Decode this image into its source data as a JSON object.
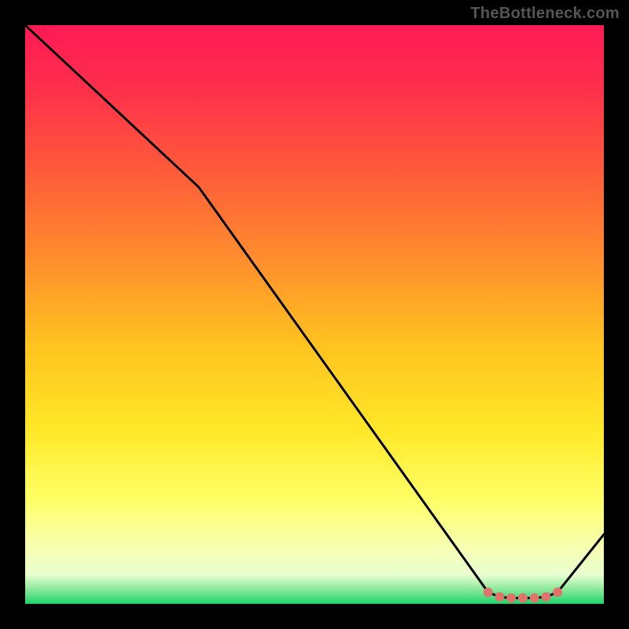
{
  "watermark": "TheBottleneck.com",
  "chart_data": {
    "type": "line",
    "title": "",
    "xlabel": "",
    "ylabel": "",
    "xlim": [
      0,
      100
    ],
    "ylim": [
      0,
      100
    ],
    "grid": false,
    "series": [
      {
        "name": "curve",
        "x": [
          0,
          30,
          80,
          82,
          84,
          86,
          88,
          90,
          92,
          100
        ],
        "values": [
          100,
          72,
          2,
          1.2,
          1,
          1,
          1,
          1.2,
          2,
          12
        ]
      }
    ],
    "markers": {
      "x": [
        80,
        82,
        84,
        86,
        88,
        90,
        92
      ],
      "values": [
        2,
        1.2,
        1,
        1,
        1,
        1.2,
        2
      ],
      "color": "#e0746b"
    },
    "background_gradient_stops": [
      {
        "offset": 0.0,
        "color": "#ff1a55"
      },
      {
        "offset": 0.1,
        "color": "#ff2d4d"
      },
      {
        "offset": 0.25,
        "color": "#ff5a3a"
      },
      {
        "offset": 0.4,
        "color": "#ff8c2e"
      },
      {
        "offset": 0.55,
        "color": "#ffc21f"
      },
      {
        "offset": 0.7,
        "color": "#ffe828"
      },
      {
        "offset": 0.82,
        "color": "#ffff66"
      },
      {
        "offset": 0.9,
        "color": "#f8ffb0"
      },
      {
        "offset": 0.95,
        "color": "#e8ffd0"
      },
      {
        "offset": 0.975,
        "color": "#8be89a"
      },
      {
        "offset": 1.0,
        "color": "#1ed46a"
      }
    ]
  }
}
